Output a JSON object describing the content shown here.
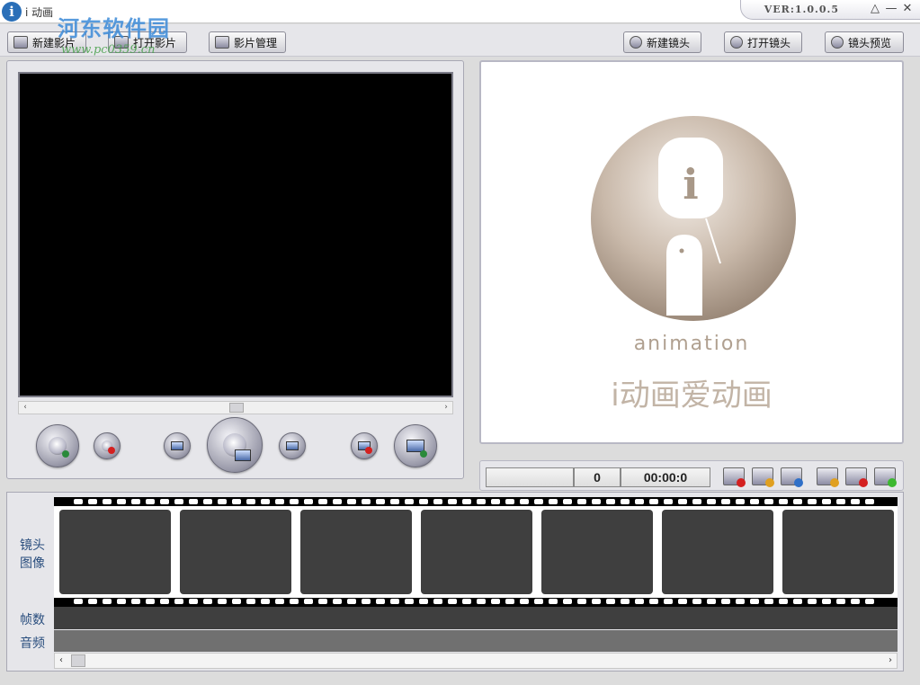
{
  "window": {
    "title": "i 动画",
    "version": "VER:1.0.0.5",
    "minimize_glyph": "—",
    "restore_glyph": "△",
    "close_glyph": "✕",
    "app_icon_glyph": "i"
  },
  "watermark": {
    "text": "河东软件园",
    "url": "www.pc0359.cn"
  },
  "toolbar": {
    "new_movie": "新建影片",
    "open_movie": "打开影片",
    "manage_movie": "影片管理",
    "new_shot": "新建镜头",
    "open_shot": "打开镜头",
    "preview_shot": "镜头预览"
  },
  "preview": {
    "logo_letter": "i",
    "logo_word": "animation",
    "logo_tagline": "i动画爱动画",
    "accent": "#b8a898"
  },
  "scroll_glyphs": {
    "left": "‹",
    "right": "›"
  },
  "status": {
    "frame_count": "0",
    "time": "00:00:0"
  },
  "timeline": {
    "shot_label_line1": "镜头",
    "shot_label_line2": "图像",
    "frames_label": "帧数",
    "audio_label": "音频"
  },
  "colors": {
    "delete_badge": "#d42020",
    "ok_badge": "#3cb830",
    "action_badge": "#2a8a3a"
  }
}
